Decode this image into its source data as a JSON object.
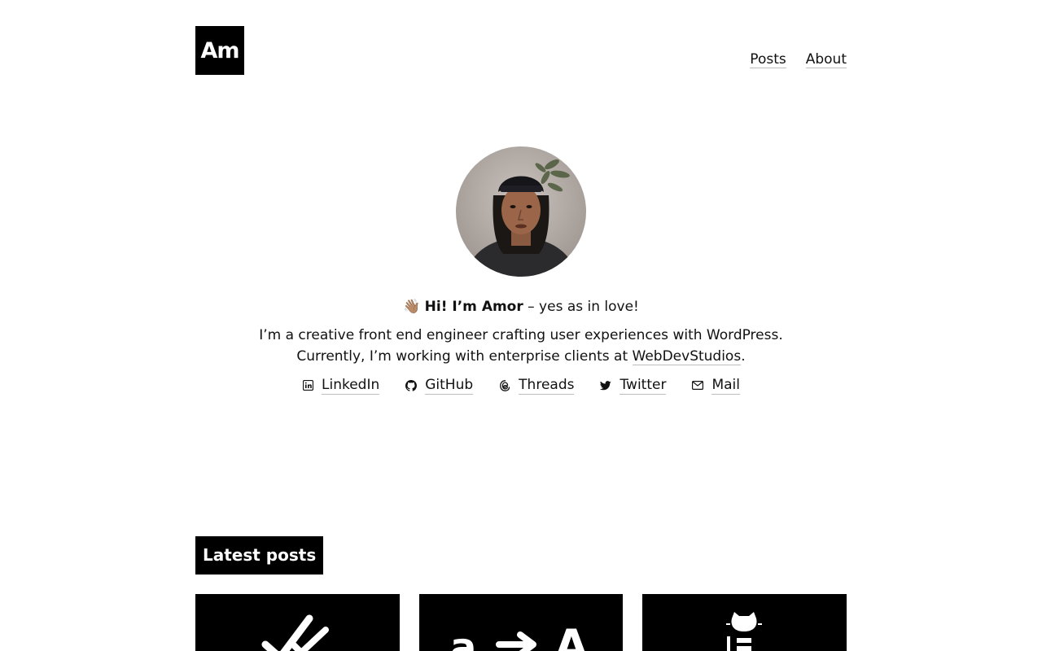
{
  "header": {
    "logo_text": "Am",
    "nav": [
      {
        "label": "Posts"
      },
      {
        "label": "About"
      }
    ]
  },
  "hero": {
    "wave_emoji": "👋🏽",
    "greeting_bold": "Hi! I’m Amor",
    "greeting_rest": " – yes as in love!",
    "bio_line1": "I’m a creative front end engineer crafting user experiences with WordPress.",
    "bio_line2_prefix": "Currently, I’m working with enterprise clients at ",
    "bio_link": "WebDevStudios",
    "bio_line2_suffix": "."
  },
  "social": [
    {
      "label": "LinkedIn",
      "icon": "linkedin-icon"
    },
    {
      "label": "GitHub",
      "icon": "github-icon"
    },
    {
      "label": "Threads",
      "icon": "threads-icon"
    },
    {
      "label": "Twitter",
      "icon": "twitter-icon"
    },
    {
      "label": "Mail",
      "icon": "mail-icon"
    }
  ],
  "latest_posts": {
    "title": "Latest posts",
    "cards": [
      {
        "icon": "checkmarks-icon"
      },
      {
        "icon": "a-to-A-icon"
      },
      {
        "icon": "octocat-icon"
      }
    ]
  },
  "colors": {
    "text": "#111111",
    "background": "#ffffff",
    "accent": "#000000",
    "underline": "#bdbdbd"
  }
}
